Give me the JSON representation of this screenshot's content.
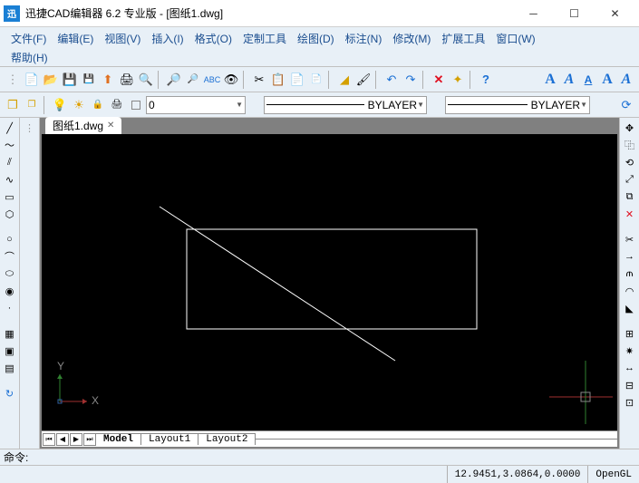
{
  "titlebar": {
    "title": "迅捷CAD编辑器 6.2 专业版  - [图纸1.dwg]"
  },
  "menu": {
    "file": "文件(F)",
    "edit": "编辑(E)",
    "view": "视图(V)",
    "insert": "插入(I)",
    "format": "格式(O)",
    "custom": "定制工具",
    "draw": "绘图(D)",
    "annotate": "标注(N)",
    "modify": "修改(M)",
    "exttools": "扩展工具",
    "window": "窗口(W)",
    "help": "帮助(H)"
  },
  "toolbar2": {
    "layer_combo": "0",
    "linetype": "BYLAYER",
    "lineweight": "BYLAYER"
  },
  "tabs": {
    "current": "图纸1.dwg"
  },
  "layout": {
    "model": "Model",
    "l1": "Layout1",
    "l2": "Layout2"
  },
  "cmd": {
    "prompt": "命令:"
  },
  "status": {
    "coords": "12.9451,3.0864,0.0000",
    "renderer": "OpenGL"
  },
  "ucs": {
    "x": "X",
    "y": "Y"
  }
}
